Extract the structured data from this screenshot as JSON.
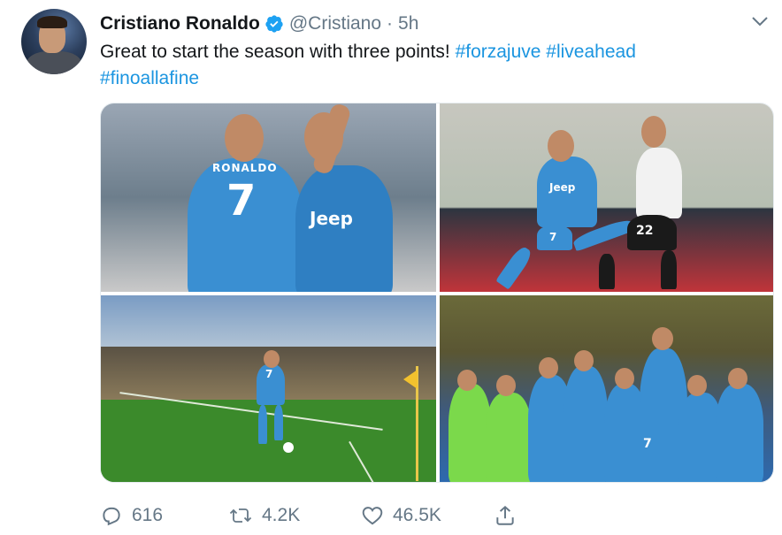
{
  "tweet": {
    "author_name": "Cristiano Ronaldo",
    "handle": "@Cristiano",
    "separator": "·",
    "time": "5h",
    "text_plain": "Great to start the season with three points!",
    "hashtags": [
      "#forzajuve",
      "#liveahead",
      "#finoallafine"
    ],
    "verified_color": "#1da1f2",
    "hashtag_color": "#1b95e0"
  },
  "media": {
    "photos": [
      {
        "label_name": "RONALDO",
        "number": "7",
        "sponsor": "Jeep"
      },
      {
        "sponsor": "Jeep",
        "number": "7",
        "opponent_number": "22"
      },
      {
        "number": "7"
      },
      {
        "number": "7"
      }
    ]
  },
  "actions": {
    "reply_count": "616",
    "retweet_count": "4.2K",
    "like_count": "46.5K",
    "icons": [
      "reply-icon",
      "retweet-icon",
      "like-icon",
      "share-icon"
    ]
  }
}
